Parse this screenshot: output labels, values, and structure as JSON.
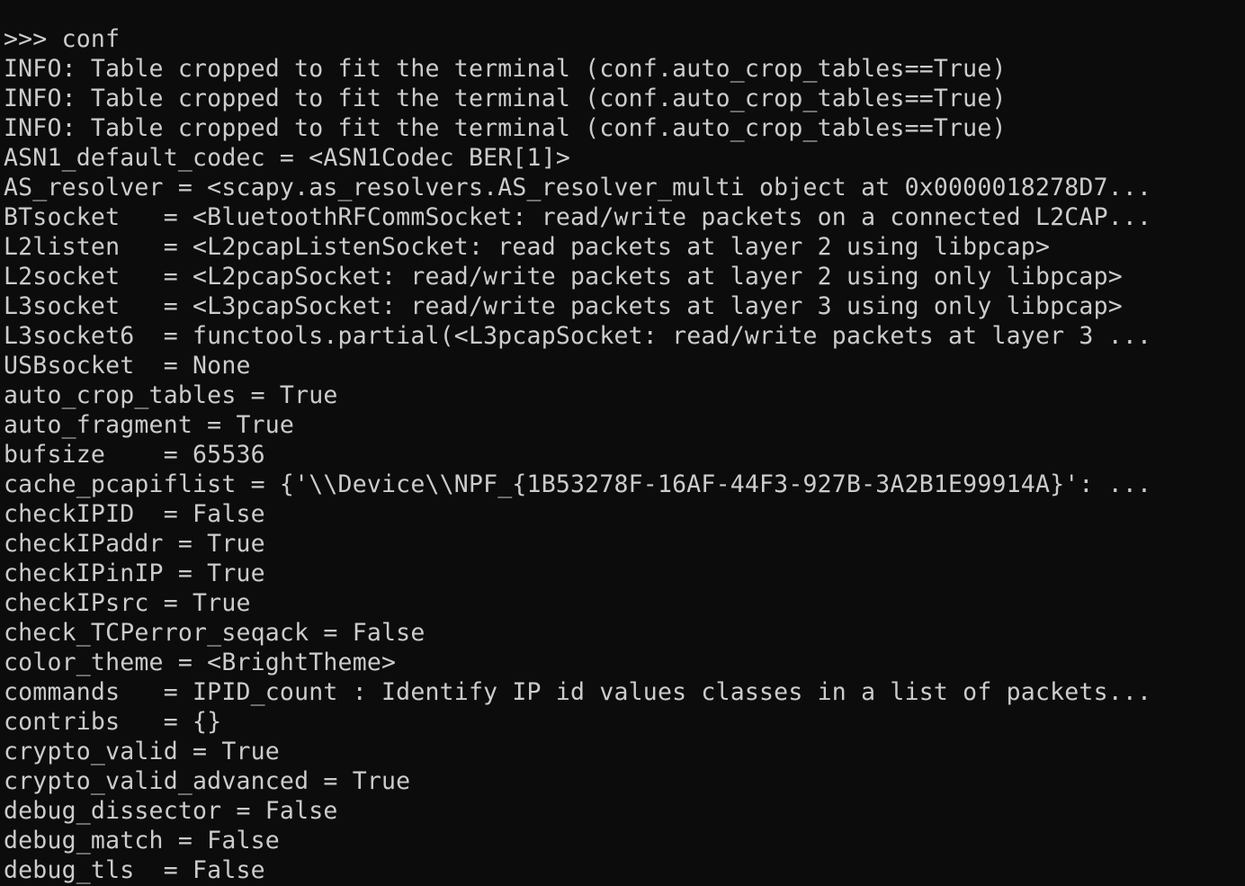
{
  "terminal": {
    "lines": [
      ">>> conf",
      "INFO: Table cropped to fit the terminal (conf.auto_crop_tables==True)",
      "INFO: Table cropped to fit the terminal (conf.auto_crop_tables==True)",
      "INFO: Table cropped to fit the terminal (conf.auto_crop_tables==True)",
      "ASN1_default_codec = <ASN1Codec BER[1]>",
      "AS_resolver = <scapy.as_resolvers.AS_resolver_multi object at 0x0000018278D7...",
      "BTsocket   = <BluetoothRFCommSocket: read/write packets on a connected L2CAP...",
      "L2listen   = <L2pcapListenSocket: read packets at layer 2 using libpcap>",
      "L2socket   = <L2pcapSocket: read/write packets at layer 2 using only libpcap>",
      "L3socket   = <L3pcapSocket: read/write packets at layer 3 using only libpcap>",
      "L3socket6  = functools.partial(<L3pcapSocket: read/write packets at layer 3 ...",
      "USBsocket  = None",
      "auto_crop_tables = True",
      "auto_fragment = True",
      "bufsize    = 65536",
      "cache_pcapiflist = {'\\\\Device\\\\NPF_{1B53278F-16AF-44F3-927B-3A2B1E99914A}': ...",
      "checkIPID  = False",
      "checkIPaddr = True",
      "checkIPinIP = True",
      "checkIPsrc = True",
      "check_TCPerror_seqack = False",
      "color_theme = <BrightTheme>",
      "commands   = IPID_count : Identify IP id values classes in a list of packets...",
      "contribs   = {}",
      "crypto_valid = True",
      "crypto_valid_advanced = True",
      "debug_dissector = False",
      "debug_match = False",
      "debug_tls  = False"
    ]
  },
  "colors": {
    "background": "#0c0c0c",
    "foreground": "#cccccc"
  }
}
